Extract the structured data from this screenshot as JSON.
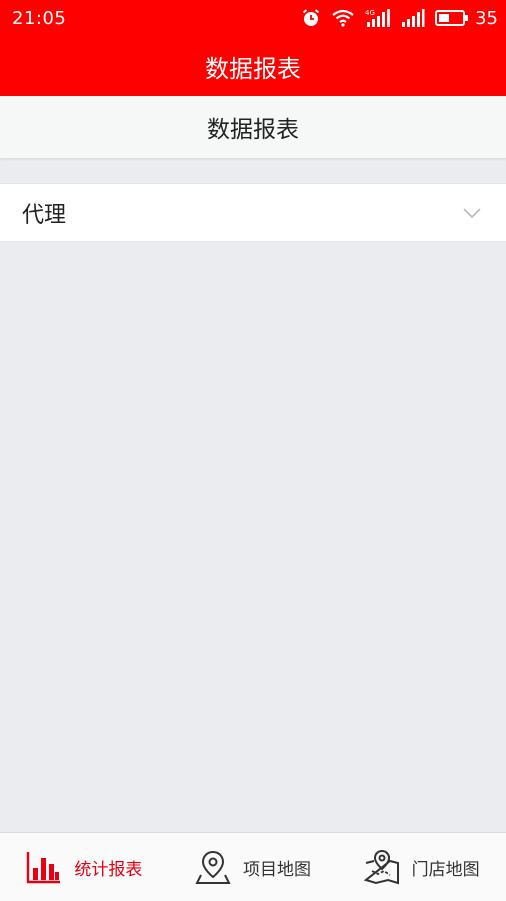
{
  "status_bar": {
    "time": "21:05",
    "battery_level": "35",
    "icons": [
      "alarm-icon",
      "wifi-icon",
      "signal-4g-icon",
      "signal-icon",
      "battery-icon"
    ]
  },
  "header": {
    "title": "数据报表"
  },
  "sub_header": {
    "title": "数据报表"
  },
  "selector": {
    "value": "代理",
    "icon": "chevron-down-icon"
  },
  "bottom_nav": {
    "items": [
      {
        "label": "统计报表",
        "icon": "bar-chart-icon",
        "active": true
      },
      {
        "label": "项目地图",
        "icon": "map-pin-icon",
        "active": false
      },
      {
        "label": "门店地图",
        "icon": "store-map-icon",
        "active": false
      }
    ]
  },
  "colors": {
    "brand_red": "#ff0000",
    "active_red": "#e60012",
    "background": "#ebecf0"
  }
}
